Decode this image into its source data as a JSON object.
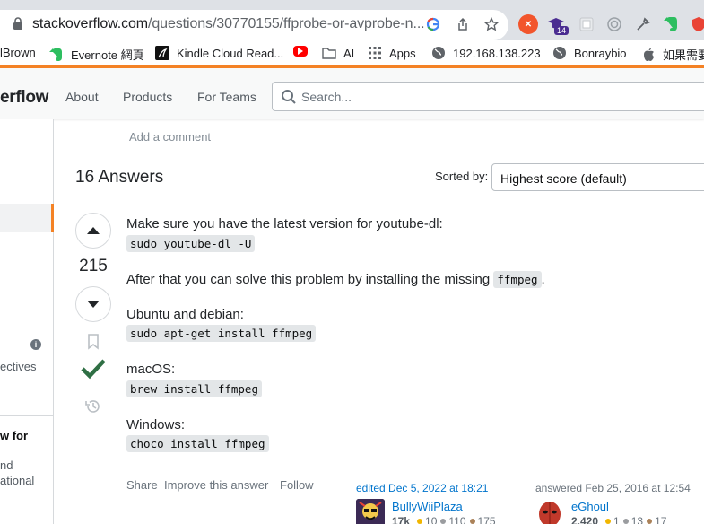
{
  "browser": {
    "url_domain": "stackoverflow.com",
    "url_path": "/questions/30770155/ffprobe-or-avprobe-n...",
    "extension_badge": "14"
  },
  "bookmarks": [
    {
      "label": "lBrown",
      "icon": "bookmark-icon"
    },
    {
      "label": "Evernote 網頁",
      "icon": "evernote-icon"
    },
    {
      "label": "Kindle Cloud Read...",
      "icon": "kindle-icon"
    },
    {
      "label": "",
      "icon": "youtube-icon"
    },
    {
      "label": "AI",
      "icon": "folder-icon"
    },
    {
      "label": "Apps",
      "icon": "apps-grid-icon"
    },
    {
      "label": "192.168.138.223",
      "icon": "globe-icon"
    },
    {
      "label": "Bonraybio",
      "icon": "globe-icon"
    },
    {
      "label": "如果需要",
      "icon": "apple-icon"
    }
  ],
  "header": {
    "logo_text": "erflow",
    "nav": [
      "About",
      "Products",
      "For Teams"
    ],
    "search_placeholder": "Search..."
  },
  "sidebar": {
    "text_collectives": "ectives",
    "text_bold": "w for",
    "text_line1": "nd",
    "text_line2": "ational"
  },
  "main": {
    "add_comment": "Add a comment",
    "answers_heading": "16 Answers",
    "sorted_by_label": "Sorted by:",
    "sort_value": "Highest score (default)"
  },
  "answer": {
    "score": "215",
    "accepted": true,
    "paragraphs": [
      "Make sure you have the latest version for youtube-dl:",
      "After that you can solve this problem by installing the missing",
      "Ubuntu and debian:",
      "macOS:",
      "Windows:"
    ],
    "inline_code": "ffmpeg",
    "period": ".",
    "code_blocks": [
      "sudo youtube-dl -U",
      "sudo apt-get install ffmpeg",
      "brew install ffmpeg",
      "choco install ffmpeg"
    ],
    "actions": [
      "Share",
      "Improve this answer",
      "Follow"
    ],
    "editor": {
      "action": "edited Dec 5, 2022 at 18:21",
      "name": "BullyWiiPlaza",
      "rep": "17k",
      "gold": "10",
      "silver": "110",
      "bronze": "175"
    },
    "author": {
      "action": "answered Feb 25, 2016 at 12:54",
      "name": "eGhoul",
      "rep": "2,420",
      "gold": "1",
      "silver": "13",
      "bronze": "17"
    }
  },
  "colors": {
    "accent": "#f48225",
    "accepted_green": "#2f6f44",
    "link": "#0074cc"
  }
}
